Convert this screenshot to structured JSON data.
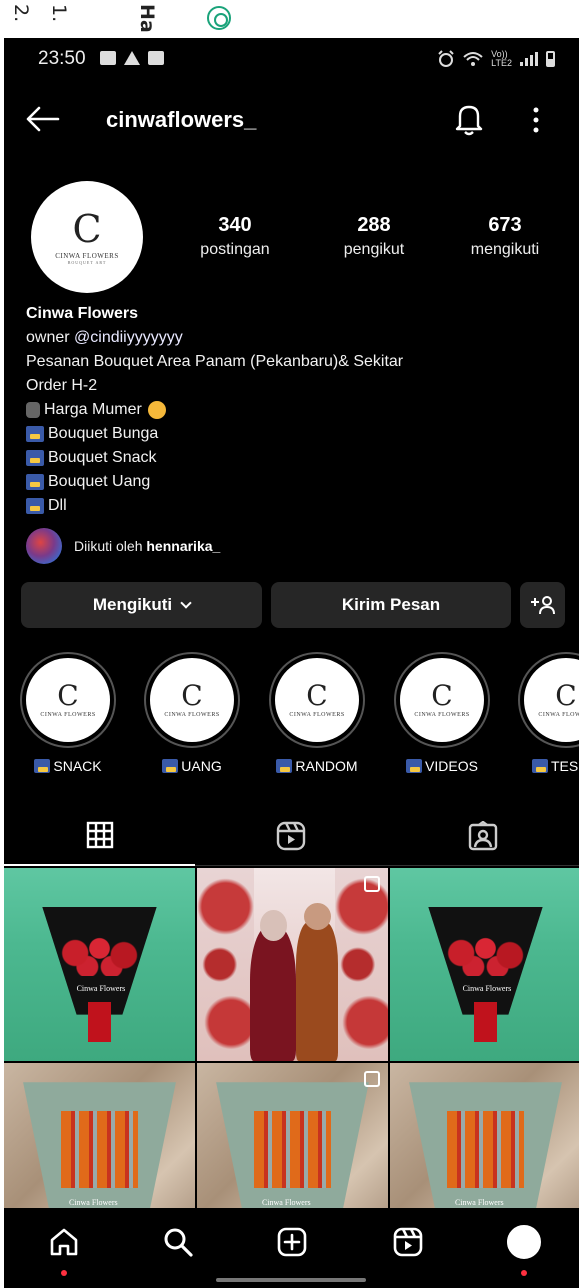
{
  "doc_strip": {
    "line1": "2.",
    "line2": "1.",
    "line3": "Ha"
  },
  "status_bar": {
    "time": "23:50",
    "network_label": "Vo))\nLTE2"
  },
  "header": {
    "username": "cinwaflowers_"
  },
  "profile": {
    "avatar_logo": {
      "letter": "C",
      "text": "CINWA FLOWERS",
      "subtext": "BOUQUET ART"
    },
    "stats": {
      "posts": {
        "value": "340",
        "label": "postingan"
      },
      "followers": {
        "value": "288",
        "label": "pengikut"
      },
      "following": {
        "value": "673",
        "label": "mengikuti"
      }
    },
    "bio": {
      "name": "Cinwa Flowers",
      "owner_prefix": "owner ",
      "owner_tag": "@cindiiyyyyyyy",
      "line1": "Pesanan Bouquet Area Panam (Pekanbaru)& Sekitar",
      "line2": "Order H-2",
      "line3": "Harga Mumer",
      "line4": "Bouquet Bunga",
      "line5": "Bouquet Snack",
      "line6": "Bouquet Uang",
      "line7": "Dll"
    },
    "followed_by_prefix": "Diikuti oleh ",
    "followed_by_user": "hennarika_"
  },
  "buttons": {
    "following": "Mengikuti",
    "message": "Kirim Pesan",
    "add_user": "+"
  },
  "highlights": [
    {
      "label": "SNACK"
    },
    {
      "label": "UANG"
    },
    {
      "label": "RANDOM"
    },
    {
      "label": "VIDEOS"
    },
    {
      "label": "TES"
    }
  ],
  "tabs": [
    "grid-icon",
    "reels-icon",
    "tagged-icon"
  ],
  "posts": [
    {
      "overlay_text": "Cinwa Flowers"
    },
    {
      "overlay_text": ""
    },
    {
      "overlay_text": "Cinwa Flowers"
    },
    {
      "overlay_text": "Cinwa Flowers"
    },
    {
      "overlay_text": "Cinwa Flowers"
    },
    {
      "overlay_text": "Cinwa Flowers"
    }
  ],
  "nav": [
    "home-icon",
    "search-icon",
    "create-icon",
    "reels-icon",
    "profile-icon"
  ],
  "colors": {
    "background": "#000000",
    "button_bg": "#262626",
    "notification_dot": "#ff3040"
  }
}
